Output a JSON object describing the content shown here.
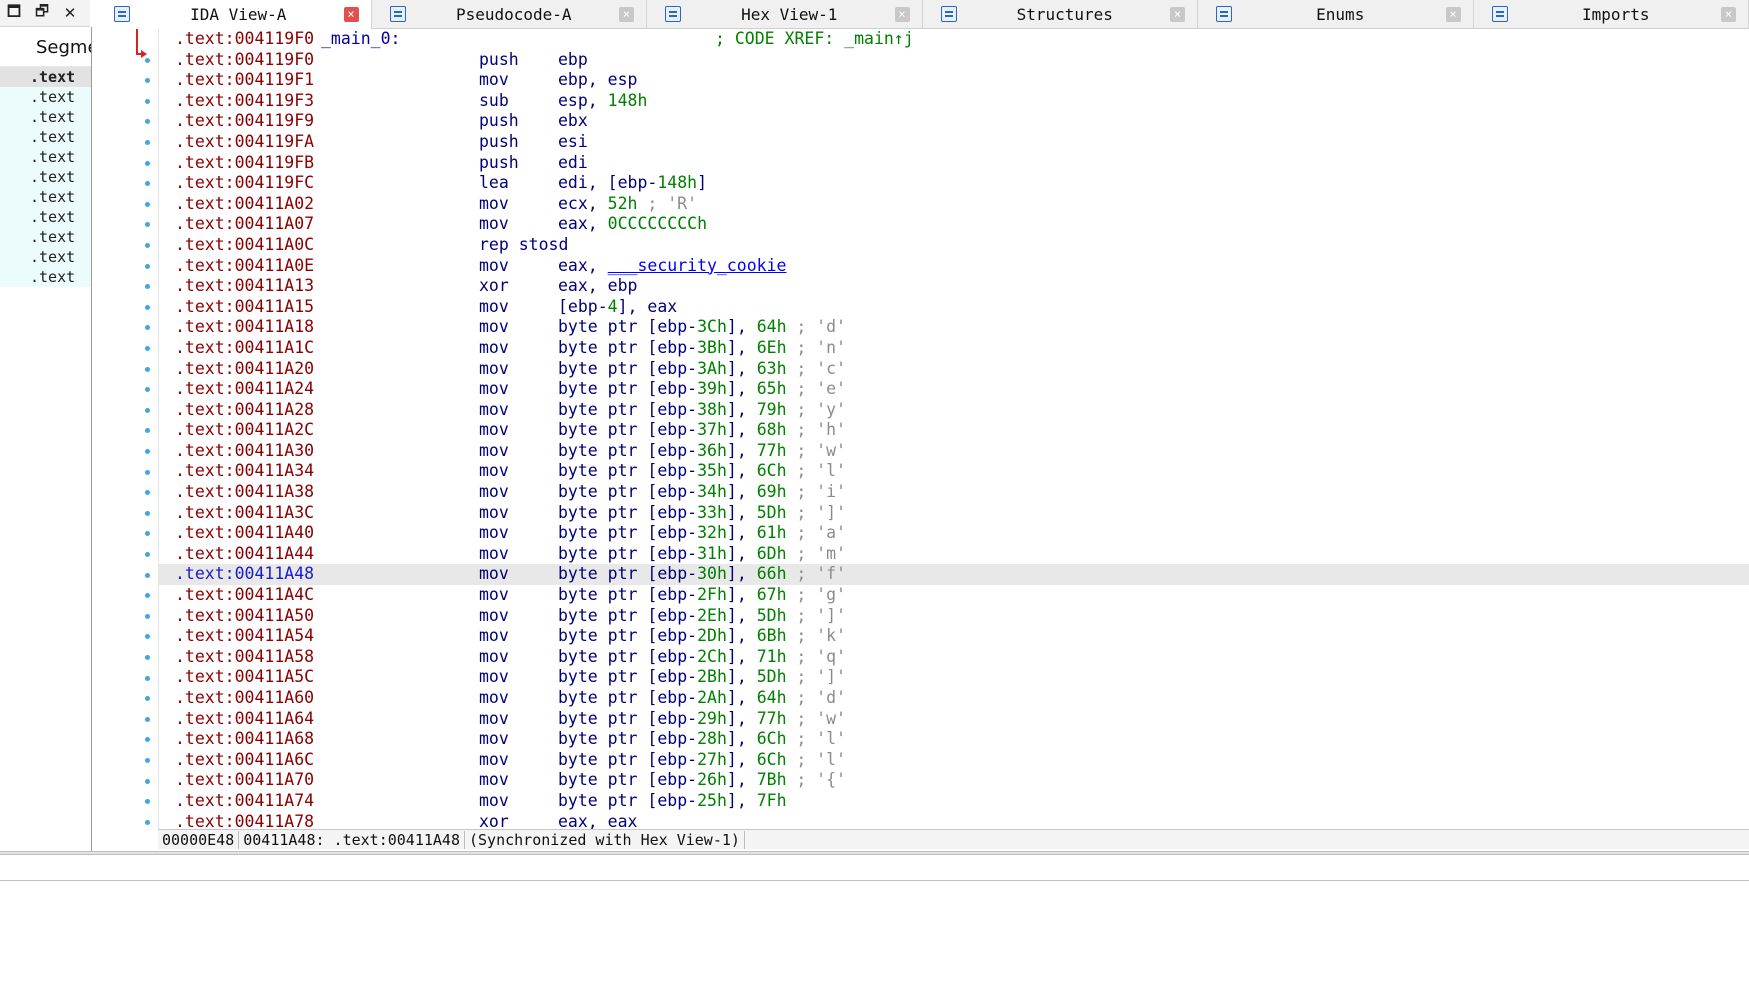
{
  "window_controls": [
    {
      "name": "restore-window-button",
      "glyph": "🗖"
    },
    {
      "name": "float-window-button",
      "glyph": "🗗"
    },
    {
      "name": "close-window-button",
      "glyph": "✕"
    }
  ],
  "segments": {
    "header": "Segme",
    "items": [
      ".text",
      ".text",
      ".text",
      ".text",
      ".text",
      ".text",
      ".text",
      ".text",
      ".text",
      ".text",
      ".text"
    ],
    "selected_index": 0
  },
  "tabs": [
    {
      "label": "IDA View-A",
      "icon": "ida-view-icon",
      "active": true,
      "close_glyph": "×"
    },
    {
      "label": "Pseudocode-A",
      "icon": "pseudocode-icon",
      "active": false,
      "close_glyph": "×"
    },
    {
      "label": "Hex View-1",
      "icon": "hex-view-icon",
      "active": false,
      "close_glyph": "×"
    },
    {
      "label": "Structures",
      "icon": "structures-icon",
      "active": false,
      "close_glyph": "×"
    },
    {
      "label": "Enums",
      "icon": "enums-icon",
      "active": false,
      "close_glyph": "×"
    },
    {
      "label": "Imports",
      "icon": "imports-icon",
      "active": false,
      "close_glyph": "×"
    }
  ],
  "listing": {
    "selected_index": 26,
    "rows": [
      {
        "addr": ".text:004119F0",
        "label": "_main_0:",
        "mn": "",
        "ops": [],
        "cmt": "",
        "xref": "; CODE XREF: _main↑j"
      },
      {
        "addr": ".text:004119F0",
        "mn": "push",
        "ops": [
          {
            "t": "ebp",
            "c": "p"
          }
        ]
      },
      {
        "addr": ".text:004119F1",
        "mn": "mov",
        "ops": [
          {
            "t": "ebp, esp",
            "c": "p"
          }
        ]
      },
      {
        "addr": ".text:004119F3",
        "mn": "sub",
        "ops": [
          {
            "t": "esp, ",
            "c": "p"
          },
          {
            "t": "148h",
            "c": "n"
          }
        ]
      },
      {
        "addr": ".text:004119F9",
        "mn": "push",
        "ops": [
          {
            "t": "ebx",
            "c": "p"
          }
        ]
      },
      {
        "addr": ".text:004119FA",
        "mn": "push",
        "ops": [
          {
            "t": "esi",
            "c": "p"
          }
        ]
      },
      {
        "addr": ".text:004119FB",
        "mn": "push",
        "ops": [
          {
            "t": "edi",
            "c": "p"
          }
        ]
      },
      {
        "addr": ".text:004119FC",
        "mn": "lea",
        "ops": [
          {
            "t": "edi, [ebp-",
            "c": "p"
          },
          {
            "t": "148h",
            "c": "n"
          },
          {
            "t": "]",
            "c": "p"
          }
        ]
      },
      {
        "addr": ".text:00411A02",
        "mn": "mov",
        "ops": [
          {
            "t": "ecx, ",
            "c": "p"
          },
          {
            "t": "52h",
            "c": "n"
          }
        ],
        "cmt": "; 'R'"
      },
      {
        "addr": ".text:00411A07",
        "mn": "mov",
        "ops": [
          {
            "t": "eax, ",
            "c": "p"
          },
          {
            "t": "0CCCCCCCCh",
            "c": "n"
          }
        ]
      },
      {
        "addr": ".text:00411A0C",
        "mn": "rep stosd",
        "ops": []
      },
      {
        "addr": ".text:00411A0E",
        "mn": "mov",
        "ops": [
          {
            "t": "eax, ",
            "c": "p"
          },
          {
            "t": "___security_cookie",
            "c": "s"
          }
        ]
      },
      {
        "addr": ".text:00411A13",
        "mn": "xor",
        "ops": [
          {
            "t": "eax, ebp",
            "c": "p"
          }
        ]
      },
      {
        "addr": ".text:00411A15",
        "mn": "mov",
        "ops": [
          {
            "t": "[ebp-",
            "c": "p"
          },
          {
            "t": "4",
            "c": "n"
          },
          {
            "t": "], eax",
            "c": "p"
          }
        ]
      },
      {
        "addr": ".text:00411A18",
        "mn": "mov",
        "ops": [
          {
            "t": "byte ptr [ebp-",
            "c": "p"
          },
          {
            "t": "3Ch",
            "c": "n"
          },
          {
            "t": "], ",
            "c": "p"
          },
          {
            "t": "64h",
            "c": "n"
          }
        ],
        "cmt": "; 'd'"
      },
      {
        "addr": ".text:00411A1C",
        "mn": "mov",
        "ops": [
          {
            "t": "byte ptr [ebp-",
            "c": "p"
          },
          {
            "t": "3Bh",
            "c": "n"
          },
          {
            "t": "], ",
            "c": "p"
          },
          {
            "t": "6Eh",
            "c": "n"
          }
        ],
        "cmt": "; 'n'"
      },
      {
        "addr": ".text:00411A20",
        "mn": "mov",
        "ops": [
          {
            "t": "byte ptr [ebp-",
            "c": "p"
          },
          {
            "t": "3Ah",
            "c": "n"
          },
          {
            "t": "], ",
            "c": "p"
          },
          {
            "t": "63h",
            "c": "n"
          }
        ],
        "cmt": "; 'c'"
      },
      {
        "addr": ".text:00411A24",
        "mn": "mov",
        "ops": [
          {
            "t": "byte ptr [ebp-",
            "c": "p"
          },
          {
            "t": "39h",
            "c": "n"
          },
          {
            "t": "], ",
            "c": "p"
          },
          {
            "t": "65h",
            "c": "n"
          }
        ],
        "cmt": "; 'e'"
      },
      {
        "addr": ".text:00411A28",
        "mn": "mov",
        "ops": [
          {
            "t": "byte ptr [ebp-",
            "c": "p"
          },
          {
            "t": "38h",
            "c": "n"
          },
          {
            "t": "], ",
            "c": "p"
          },
          {
            "t": "79h",
            "c": "n"
          }
        ],
        "cmt": "; 'y'"
      },
      {
        "addr": ".text:00411A2C",
        "mn": "mov",
        "ops": [
          {
            "t": "byte ptr [ebp-",
            "c": "p"
          },
          {
            "t": "37h",
            "c": "n"
          },
          {
            "t": "], ",
            "c": "p"
          },
          {
            "t": "68h",
            "c": "n"
          }
        ],
        "cmt": "; 'h'"
      },
      {
        "addr": ".text:00411A30",
        "mn": "mov",
        "ops": [
          {
            "t": "byte ptr [ebp-",
            "c": "p"
          },
          {
            "t": "36h",
            "c": "n"
          },
          {
            "t": "], ",
            "c": "p"
          },
          {
            "t": "77h",
            "c": "n"
          }
        ],
        "cmt": "; 'w'"
      },
      {
        "addr": ".text:00411A34",
        "mn": "mov",
        "ops": [
          {
            "t": "byte ptr [ebp-",
            "c": "p"
          },
          {
            "t": "35h",
            "c": "n"
          },
          {
            "t": "], ",
            "c": "p"
          },
          {
            "t": "6Ch",
            "c": "n"
          }
        ],
        "cmt": "; 'l'"
      },
      {
        "addr": ".text:00411A38",
        "mn": "mov",
        "ops": [
          {
            "t": "byte ptr [ebp-",
            "c": "p"
          },
          {
            "t": "34h",
            "c": "n"
          },
          {
            "t": "], ",
            "c": "p"
          },
          {
            "t": "69h",
            "c": "n"
          }
        ],
        "cmt": "; 'i'"
      },
      {
        "addr": ".text:00411A3C",
        "mn": "mov",
        "ops": [
          {
            "t": "byte ptr [ebp-",
            "c": "p"
          },
          {
            "t": "33h",
            "c": "n"
          },
          {
            "t": "], ",
            "c": "p"
          },
          {
            "t": "5Dh",
            "c": "n"
          }
        ],
        "cmt": "; ']'"
      },
      {
        "addr": ".text:00411A40",
        "mn": "mov",
        "ops": [
          {
            "t": "byte ptr [ebp-",
            "c": "p"
          },
          {
            "t": "32h",
            "c": "n"
          },
          {
            "t": "], ",
            "c": "p"
          },
          {
            "t": "61h",
            "c": "n"
          }
        ],
        "cmt": "; 'a'"
      },
      {
        "addr": ".text:00411A44",
        "mn": "mov",
        "ops": [
          {
            "t": "byte ptr [ebp-",
            "c": "p"
          },
          {
            "t": "31h",
            "c": "n"
          },
          {
            "t": "], ",
            "c": "p"
          },
          {
            "t": "6Dh",
            "c": "n"
          }
        ],
        "cmt": "; 'm'"
      },
      {
        "addr": ".text:00411A48",
        "mn": "mov",
        "ops": [
          {
            "t": "byte ptr [ebp-",
            "c": "p"
          },
          {
            "t": "30h",
            "c": "n"
          },
          {
            "t": "], ",
            "c": "p"
          },
          {
            "t": "66h",
            "c": "n"
          }
        ],
        "cmt": "; 'f'"
      },
      {
        "addr": ".text:00411A4C",
        "mn": "mov",
        "ops": [
          {
            "t": "byte ptr [ebp-",
            "c": "p"
          },
          {
            "t": "2Fh",
            "c": "n"
          },
          {
            "t": "], ",
            "c": "p"
          },
          {
            "t": "67h",
            "c": "n"
          }
        ],
        "cmt": "; 'g'"
      },
      {
        "addr": ".text:00411A50",
        "mn": "mov",
        "ops": [
          {
            "t": "byte ptr [ebp-",
            "c": "p"
          },
          {
            "t": "2Eh",
            "c": "n"
          },
          {
            "t": "], ",
            "c": "p"
          },
          {
            "t": "5Dh",
            "c": "n"
          }
        ],
        "cmt": "; ']'"
      },
      {
        "addr": ".text:00411A54",
        "mn": "mov",
        "ops": [
          {
            "t": "byte ptr [ebp-",
            "c": "p"
          },
          {
            "t": "2Dh",
            "c": "n"
          },
          {
            "t": "], ",
            "c": "p"
          },
          {
            "t": "6Bh",
            "c": "n"
          }
        ],
        "cmt": "; 'k'"
      },
      {
        "addr": ".text:00411A58",
        "mn": "mov",
        "ops": [
          {
            "t": "byte ptr [ebp-",
            "c": "p"
          },
          {
            "t": "2Ch",
            "c": "n"
          },
          {
            "t": "], ",
            "c": "p"
          },
          {
            "t": "71h",
            "c": "n"
          }
        ],
        "cmt": "; 'q'"
      },
      {
        "addr": ".text:00411A5C",
        "mn": "mov",
        "ops": [
          {
            "t": "byte ptr [ebp-",
            "c": "p"
          },
          {
            "t": "2Bh",
            "c": "n"
          },
          {
            "t": "], ",
            "c": "p"
          },
          {
            "t": "5Dh",
            "c": "n"
          }
        ],
        "cmt": "; ']'"
      },
      {
        "addr": ".text:00411A60",
        "mn": "mov",
        "ops": [
          {
            "t": "byte ptr [ebp-",
            "c": "p"
          },
          {
            "t": "2Ah",
            "c": "n"
          },
          {
            "t": "], ",
            "c": "p"
          },
          {
            "t": "64h",
            "c": "n"
          }
        ],
        "cmt": "; 'd'"
      },
      {
        "addr": ".text:00411A64",
        "mn": "mov",
        "ops": [
          {
            "t": "byte ptr [ebp-",
            "c": "p"
          },
          {
            "t": "29h",
            "c": "n"
          },
          {
            "t": "], ",
            "c": "p"
          },
          {
            "t": "77h",
            "c": "n"
          }
        ],
        "cmt": "; 'w'"
      },
      {
        "addr": ".text:00411A68",
        "mn": "mov",
        "ops": [
          {
            "t": "byte ptr [ebp-",
            "c": "p"
          },
          {
            "t": "28h",
            "c": "n"
          },
          {
            "t": "], ",
            "c": "p"
          },
          {
            "t": "6Ch",
            "c": "n"
          }
        ],
        "cmt": "; 'l'"
      },
      {
        "addr": ".text:00411A6C",
        "mn": "mov",
        "ops": [
          {
            "t": "byte ptr [ebp-",
            "c": "p"
          },
          {
            "t": "27h",
            "c": "n"
          },
          {
            "t": "], ",
            "c": "p"
          },
          {
            "t": "6Ch",
            "c": "n"
          }
        ],
        "cmt": "; 'l'"
      },
      {
        "addr": ".text:00411A70",
        "mn": "mov",
        "ops": [
          {
            "t": "byte ptr [ebp-",
            "c": "p"
          },
          {
            "t": "26h",
            "c": "n"
          },
          {
            "t": "], ",
            "c": "p"
          },
          {
            "t": "7Bh",
            "c": "n"
          }
        ],
        "cmt": "; '{'"
      },
      {
        "addr": ".text:00411A74",
        "mn": "mov",
        "ops": [
          {
            "t": "byte ptr [ebp-",
            "c": "p"
          },
          {
            "t": "25h",
            "c": "n"
          },
          {
            "t": "], ",
            "c": "p"
          },
          {
            "t": "7Fh",
            "c": "n"
          }
        ]
      },
      {
        "addr": ".text:00411A78",
        "mn": "xor",
        "ops": [
          {
            "t": "eax, eax",
            "c": "p"
          }
        ]
      }
    ]
  },
  "status": {
    "file_offset": "00000E48",
    "address": "00411A48: .text:00411A48",
    "sync": "(Synchronized with Hex View-1)"
  },
  "colors": {
    "address": "#8b0000",
    "address_selected": "#1a1ad0",
    "number": "#008000",
    "symbol": "#0000ff",
    "comment": "#8c8c8c",
    "gutter_dot": "#49a3e0",
    "segment_bg": "#ecfbfc"
  }
}
